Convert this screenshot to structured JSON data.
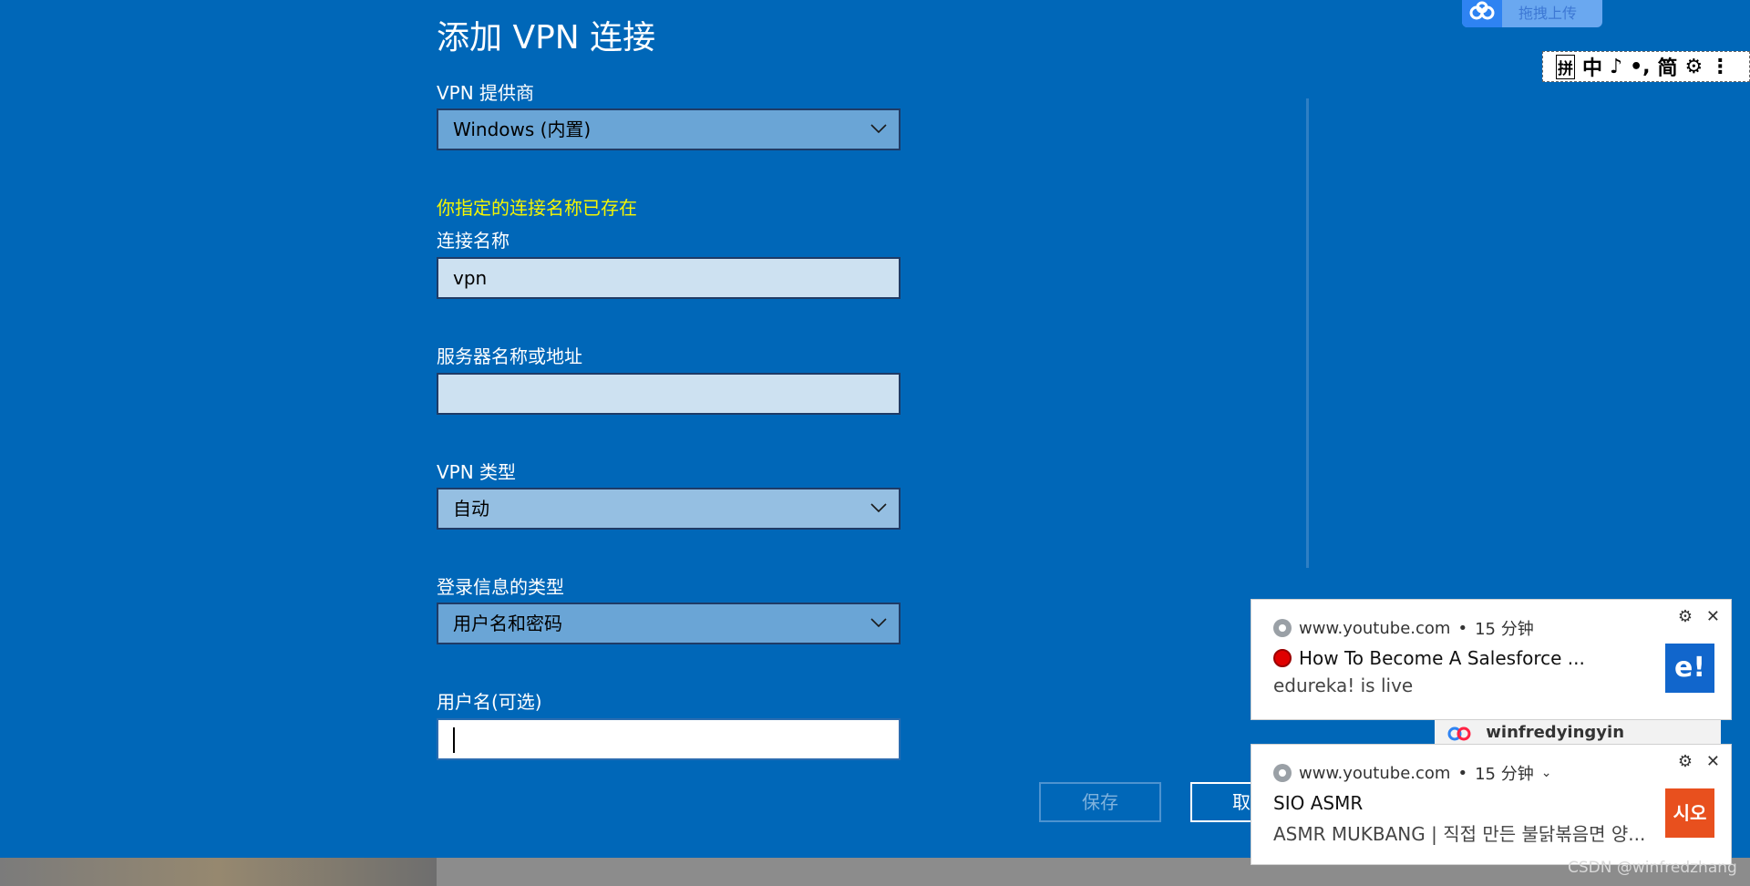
{
  "dialog": {
    "title": "添加 VPN 连接",
    "provider_label": "VPN 提供商",
    "provider_value": "Windows (内置)",
    "name_error": "你指定的连接名称已存在",
    "name_label": "连接名称",
    "name_value": "vpn",
    "server_label": "服务器名称或地址",
    "server_value": "",
    "type_label": "VPN 类型",
    "type_value": "自动",
    "signin_label": "登录信息的类型",
    "signin_value": "用户名和密码",
    "username_label": "用户名(可选)",
    "username_value": "",
    "save_label": "保存",
    "cancel_label": "取"
  },
  "upload_widget": {
    "label": "拖拽上传"
  },
  "ime_toolbar": {
    "items": [
      "拼",
      "中",
      "♪",
      "•,",
      "简",
      "⚙",
      "⋮"
    ]
  },
  "notifications": [
    {
      "source": "www.youtube.com",
      "time": "15 分钟",
      "title": "How To Become A Salesforce ...",
      "subtitle": "edureka! is live",
      "thumb_text": "e!",
      "thumb_color": "#1166cc"
    },
    {
      "source": "www.youtube.com",
      "time": "15 分钟",
      "title": "SIO ASMR",
      "subtitle": "ASMR MUKBANG | 직접 만든 불닭볶음면 양...",
      "thumb_text": "시오",
      "thumb_color": "#e8501e"
    }
  ],
  "background_strip": {
    "label": "winfredyingyin"
  },
  "watermark": "CSDN @winfredzhang",
  "colors": {
    "background": "#0067b8",
    "warning": "#f6f600",
    "field": "#cde1f1"
  }
}
